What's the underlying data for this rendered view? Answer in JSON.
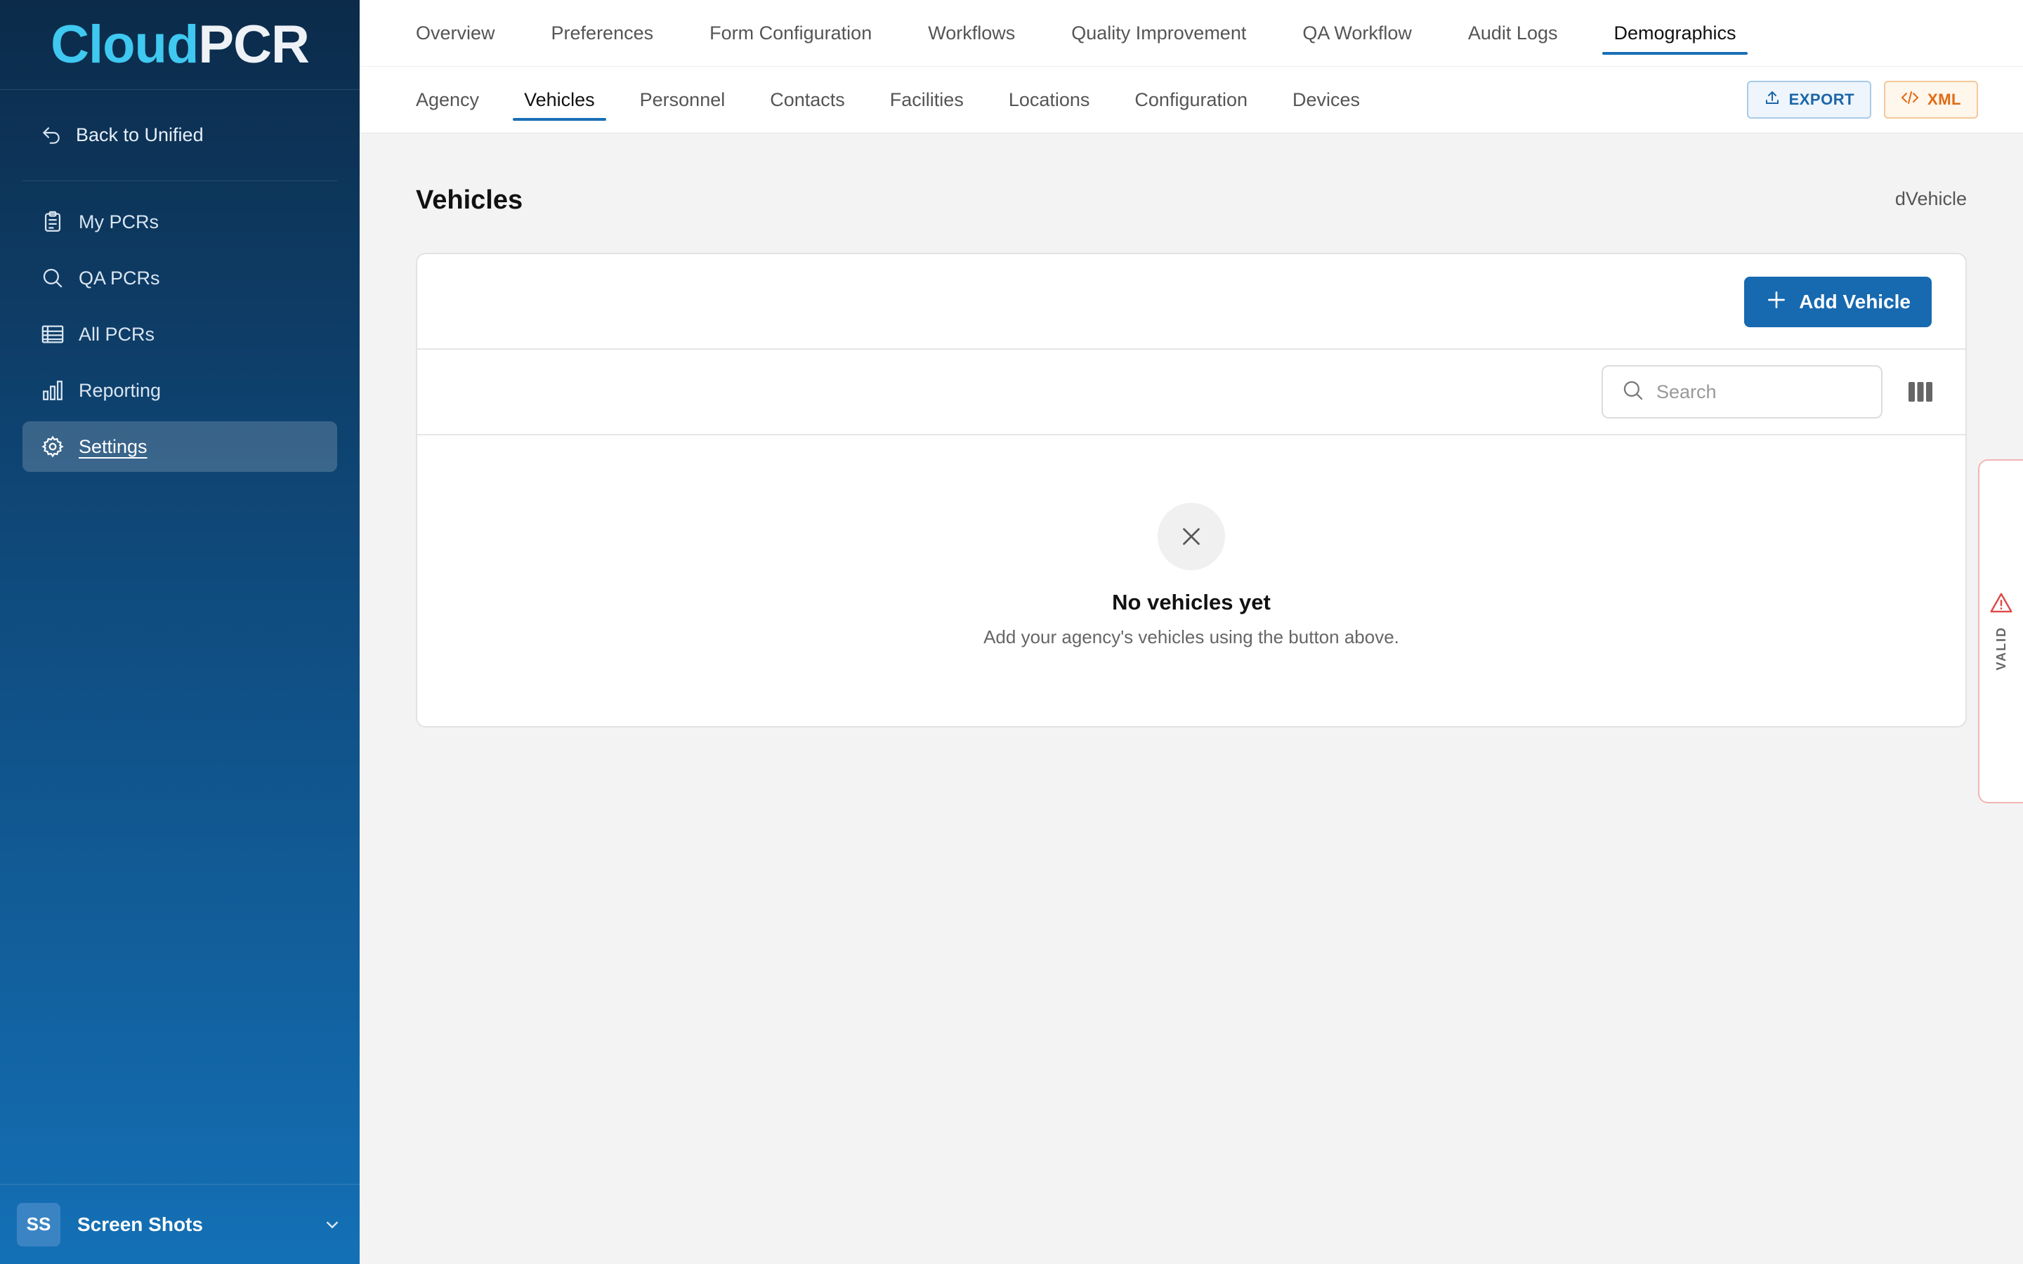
{
  "app": {
    "logo_part1": "Cloud",
    "logo_part2": "PCR"
  },
  "sidebar": {
    "back_label": "Back to Unified",
    "items": [
      {
        "label": "My PCRs",
        "icon": "clipboard-icon"
      },
      {
        "label": "QA PCRs",
        "icon": "search-icon"
      },
      {
        "label": "All PCRs",
        "icon": "table-icon"
      },
      {
        "label": "Reporting",
        "icon": "bar-chart-icon"
      },
      {
        "label": "Settings",
        "icon": "gear-icon",
        "active": true
      }
    ],
    "footer": {
      "initials": "SS",
      "name": "Screen Shots"
    }
  },
  "top_tabs": [
    {
      "label": "Overview"
    },
    {
      "label": "Preferences"
    },
    {
      "label": "Form Configuration"
    },
    {
      "label": "Workflows"
    },
    {
      "label": "Quality Improvement"
    },
    {
      "label": "QA Workflow"
    },
    {
      "label": "Audit Logs"
    },
    {
      "label": "Demographics",
      "active": true
    }
  ],
  "sub_tabs": [
    {
      "label": "Agency"
    },
    {
      "label": "Vehicles",
      "active": true
    },
    {
      "label": "Personnel"
    },
    {
      "label": "Contacts"
    },
    {
      "label": "Facilities"
    },
    {
      "label": "Locations"
    },
    {
      "label": "Configuration"
    },
    {
      "label": "Devices"
    }
  ],
  "actions": {
    "export_label": "EXPORT",
    "xml_label": "XML"
  },
  "page": {
    "title": "Vehicles",
    "code": "dVehicle"
  },
  "card": {
    "add_button_label": "Add Vehicle",
    "search_placeholder": "Search",
    "empty_title": "No vehicles yet",
    "empty_subtitle": "Add your agency's vehicles using the button above."
  },
  "validation": {
    "label": "VALID"
  },
  "colors": {
    "accent": "#1769b0",
    "logo_cloud": "#3fc8f0",
    "xml_orange": "#e06b12",
    "warning_red": "#e04848"
  }
}
